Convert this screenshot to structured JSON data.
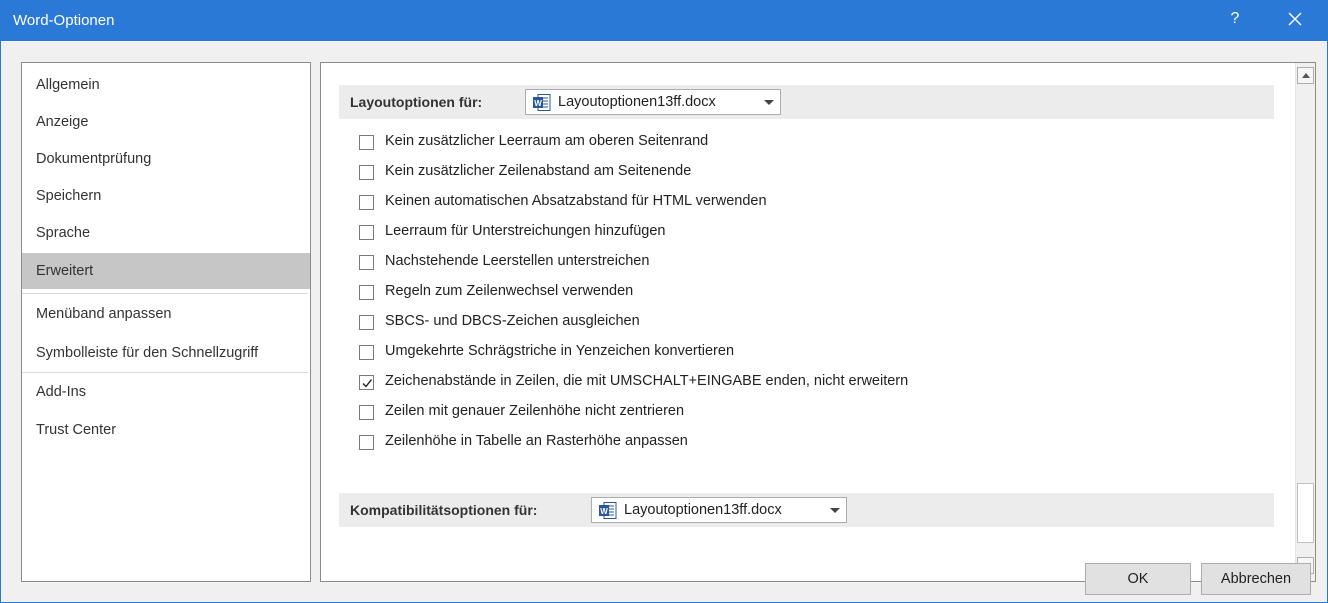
{
  "window": {
    "title": "Word-Optionen",
    "help": "?"
  },
  "sidebar": {
    "items": [
      {
        "label": "Allgemein"
      },
      {
        "label": "Anzeige"
      },
      {
        "label": "Dokumentprüfung"
      },
      {
        "label": "Speichern"
      },
      {
        "label": "Sprache"
      },
      {
        "label": "Erweitert",
        "selected": true
      },
      {
        "label": "Menüband anpassen"
      },
      {
        "label": "Symbolleiste für den Schnellzugriff"
      },
      {
        "label": "Add-Ins"
      },
      {
        "label": "Trust Center"
      }
    ]
  },
  "layout_section": {
    "label": "Layoutoptionen für:",
    "document": "Layoutoptionen13ff.docx",
    "options": [
      {
        "label": "Kein zusätzlicher Leerraum am oberen Seitenrand",
        "checked": false
      },
      {
        "label": "Kein zusätzlicher Zeilenabstand am Seitenende",
        "checked": false
      },
      {
        "label": "Keinen automatischen Absatzabstand für HTML verwenden",
        "checked": false
      },
      {
        "label": "Leerraum für Unterstreichungen hinzufügen",
        "checked": false
      },
      {
        "label": "Nachstehende Leerstellen unterstreichen",
        "checked": false
      },
      {
        "label": "Regeln zum Zeilenwechsel verwenden",
        "checked": false
      },
      {
        "label": "SBCS- und DBCS-Zeichen ausgleichen",
        "checked": false
      },
      {
        "label": "Umgekehrte Schrägstriche in Yenzeichen konvertieren",
        "checked": false
      },
      {
        "label": "Zeichenabstände in Zeilen, die mit UMSCHALT+EINGABE enden, nicht erweitern",
        "checked": true
      },
      {
        "label": "Zeilen mit genauer Zeilenhöhe nicht zentrieren",
        "checked": false
      },
      {
        "label": "Zeilenhöhe in Tabelle an Rasterhöhe anpassen",
        "checked": false
      }
    ]
  },
  "compat_section": {
    "label": "Kompatibilitätsoptionen für:",
    "document": "Layoutoptionen13ff.docx"
  },
  "buttons": {
    "ok": "OK",
    "cancel": "Abbrechen"
  },
  "colors": {
    "titlebar": "#2b79d6",
    "selected_nav": "#c6c6c6"
  }
}
